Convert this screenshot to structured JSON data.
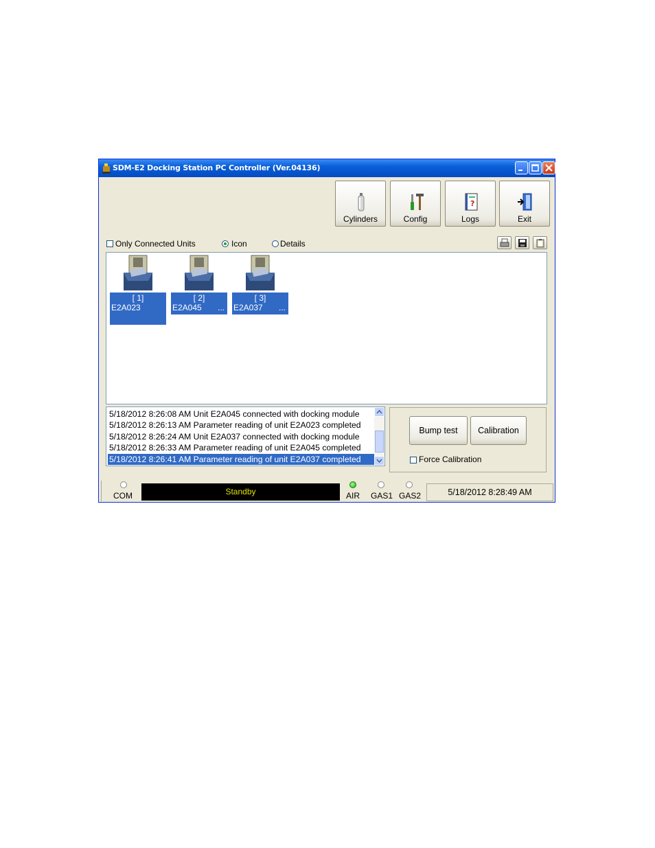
{
  "window": {
    "title": "SDM-E2 Docking Station PC Controller (Ver.04136)"
  },
  "toolbar": {
    "buttons": [
      {
        "label": "Cylinders",
        "icon": "cylinder-icon"
      },
      {
        "label": "Config",
        "icon": "tools-icon"
      },
      {
        "label": "Logs",
        "icon": "logbook-icon"
      },
      {
        "label": "Exit",
        "icon": "exit-door-icon"
      }
    ]
  },
  "view_options": {
    "only_connected_label": "Only Connected Units",
    "only_connected_checked": false,
    "icon_label": "Icon",
    "details_label": "Details",
    "selected_view": "Icon"
  },
  "units": [
    {
      "slot": "[ 1]",
      "name": "E2A023",
      "ellipsis": ""
    },
    {
      "slot": "[ 2]",
      "name": "E2A045",
      "ellipsis": "..."
    },
    {
      "slot": "[ 3]",
      "name": "E2A037",
      "ellipsis": "..."
    }
  ],
  "log": [
    "5/18/2012 8:26:08 AM Unit E2A045 connected with docking module",
    "5/18/2012 8:26:13 AM Parameter reading of unit E2A023 completed",
    "5/18/2012 8:26:24 AM Unit E2A037 connected with docking module",
    "5/18/2012 8:26:33 AM Parameter reading of unit E2A045 completed",
    "5/18/2012 8:26:41 AM Parameter reading of unit E2A037 completed"
  ],
  "actions": {
    "bump_label": "Bump test",
    "calibration_label": "Calibration",
    "force_label": "Force Calibration",
    "force_checked": false
  },
  "status": {
    "com_label": "COM",
    "state": "Standby",
    "air_label": "AIR",
    "gas1_label": "GAS1",
    "gas2_label": "GAS2",
    "datetime": "5/18/2012 8:28:49 AM",
    "led_active_color": "#1ba21b",
    "standby_text_color": "#e3e308"
  }
}
